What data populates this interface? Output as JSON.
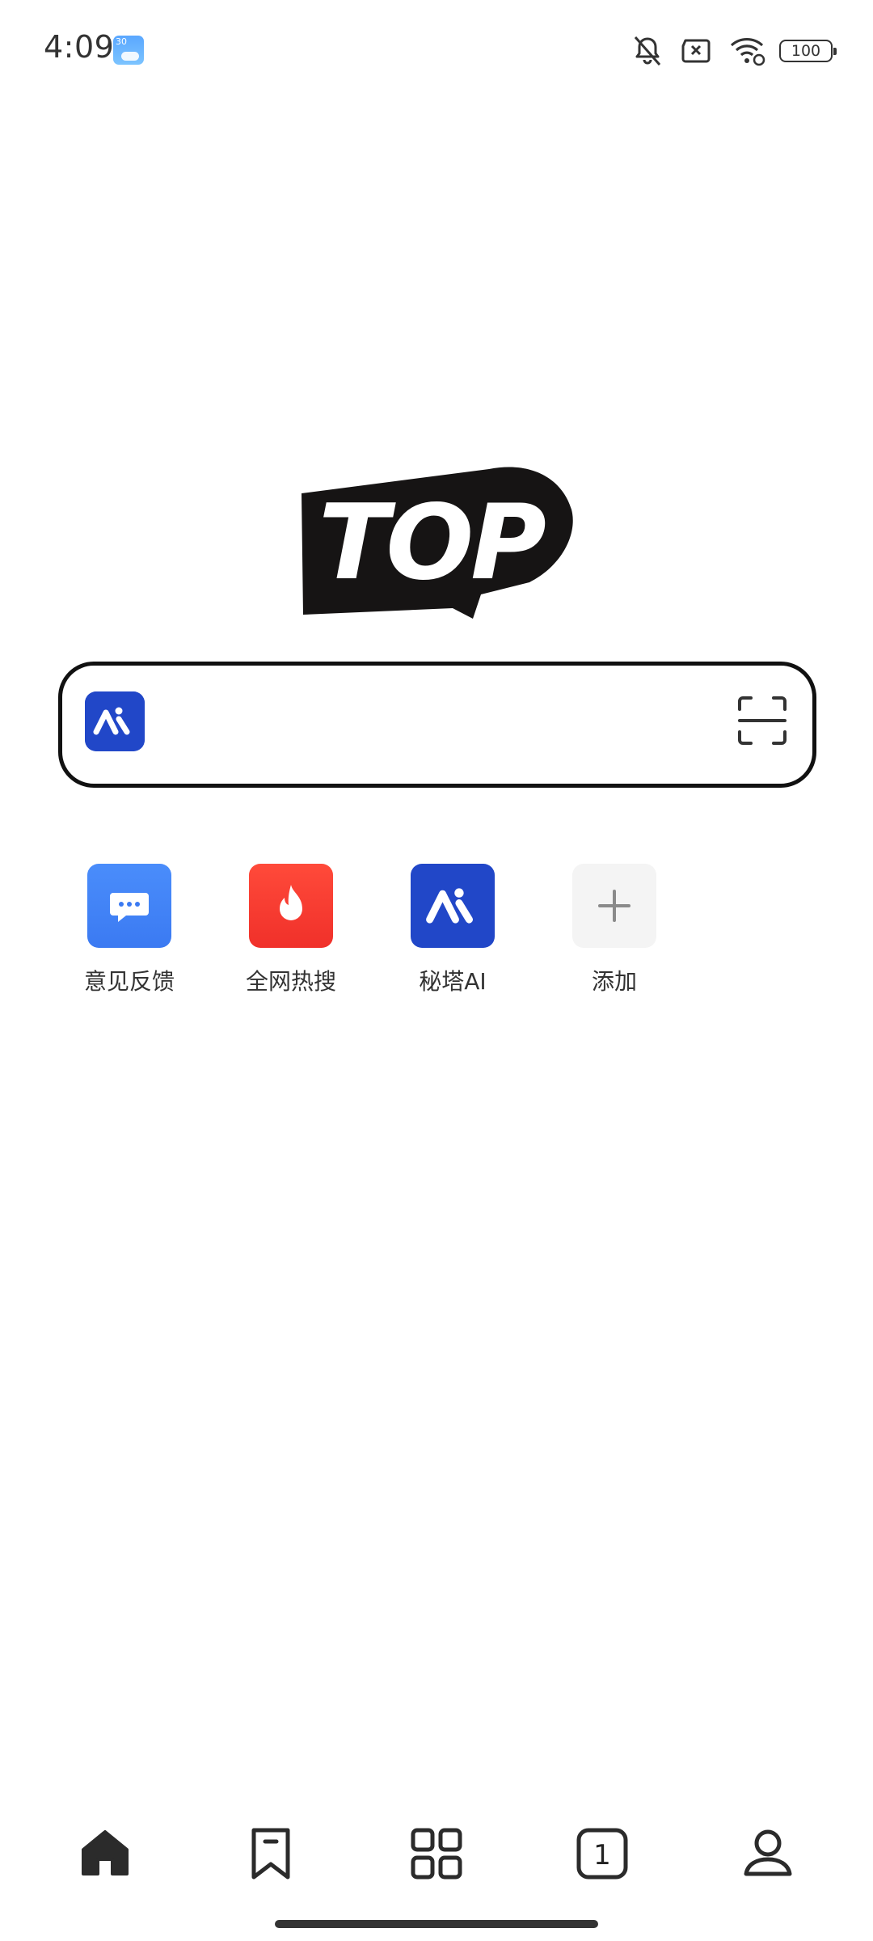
{
  "status_bar": {
    "time": "4:09",
    "weather_temp": "30",
    "battery": "100",
    "icons": [
      "bell-muted-icon",
      "sim-off-icon",
      "wifi-icon",
      "battery-icon"
    ]
  },
  "logo": {
    "text": "TOP"
  },
  "search": {
    "value": "",
    "placeholder": ""
  },
  "shortcuts": [
    {
      "label": "意见反馈",
      "icon": "chat-bubble-icon",
      "color": "#3b7af2"
    },
    {
      "label": "全网热搜",
      "icon": "flame-icon",
      "color": "#f0302a"
    },
    {
      "label": "秘塔AI",
      "icon": "metaso-ai-logo",
      "color": "#2147c8"
    },
    {
      "label": "添加",
      "icon": "plus-icon",
      "color": "#f4f4f4"
    }
  ],
  "bottom_nav": {
    "items": [
      "home-icon",
      "bookmark-icon",
      "apps-grid-icon",
      "tabs-icon",
      "profile-icon"
    ],
    "tab_count": "1"
  },
  "colors": {
    "accent": "#2147c8",
    "text": "#333333"
  }
}
